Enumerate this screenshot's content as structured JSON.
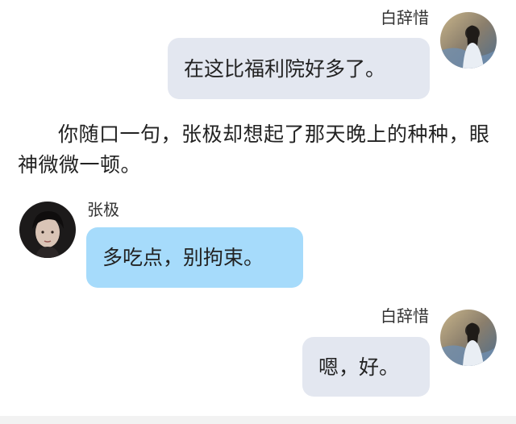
{
  "messages": [
    {
      "sender": "白辞惜",
      "text": "在这比福利院好多了。"
    },
    {
      "narration": "你随口一句，张极却想起了那天晚上的种种，眼神微微一顿。"
    },
    {
      "sender": "张极",
      "text": "多吃点，别拘束。"
    },
    {
      "sender": "白辞惜",
      "text": "嗯，好。"
    }
  ],
  "colors": {
    "self_bubble": "#e3e7f0",
    "other_bubble": "#a6dbfb"
  }
}
